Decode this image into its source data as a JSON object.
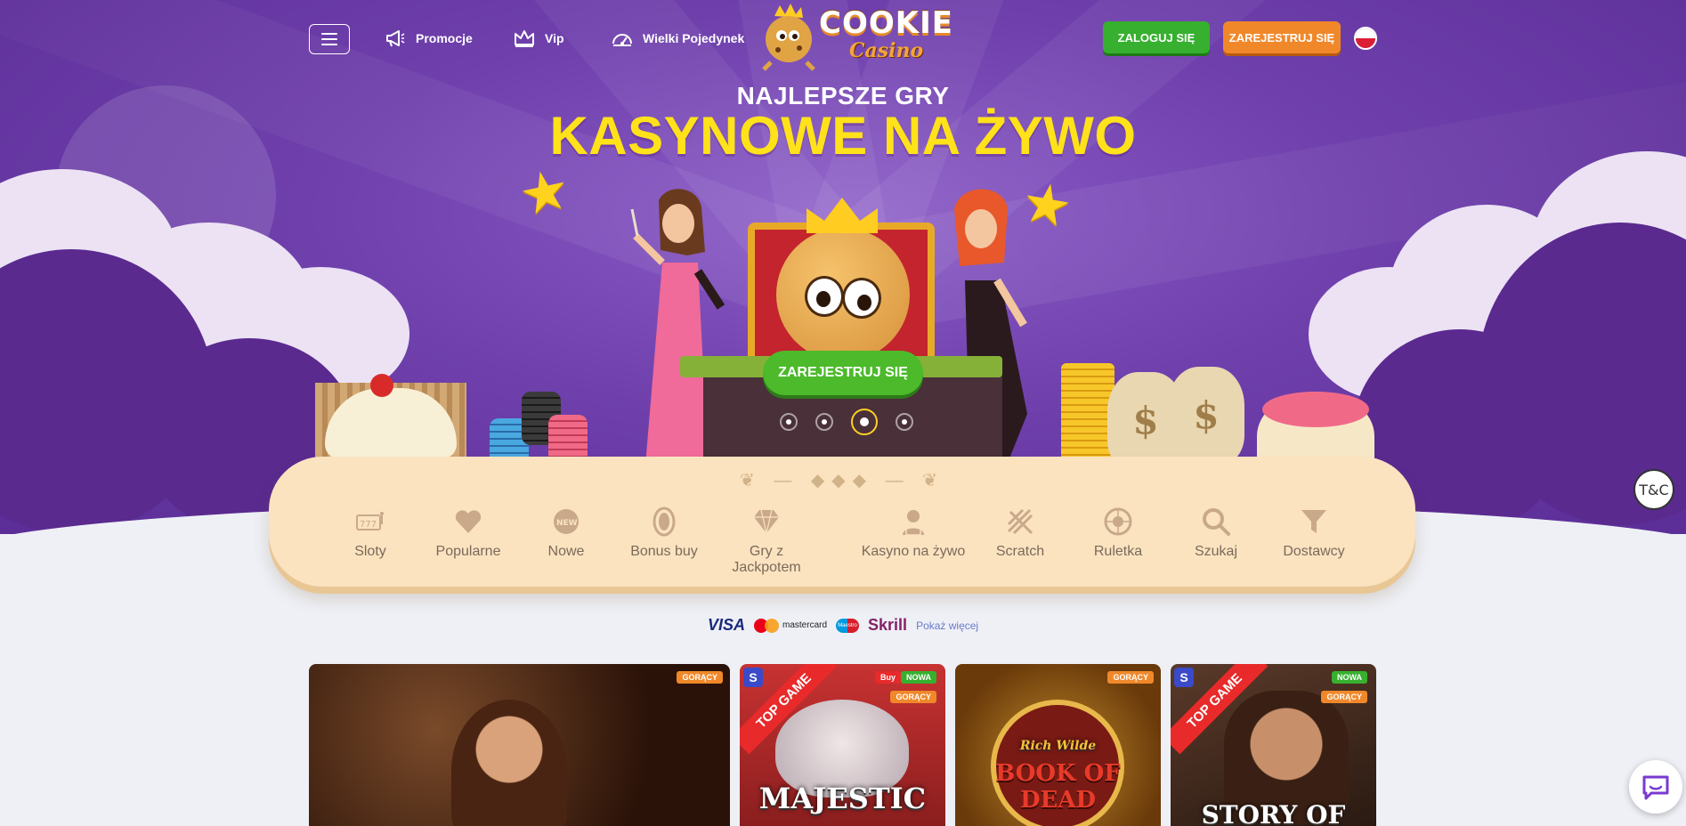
{
  "header": {
    "menu_icon": "hamburger-icon",
    "nav": [
      {
        "label": "Promocje",
        "icon": "megaphone-icon"
      },
      {
        "label": "Vip",
        "icon": "crown-icon"
      },
      {
        "label": "Wielki Pojedynek",
        "icon": "speedometer-icon"
      }
    ],
    "logo_text": "COOKIE",
    "logo_subtext": "Casino",
    "login_label": "ZALOGUJ SIĘ",
    "register_label": "ZAREJESTRUJ SIĘ",
    "language_flag": "poland-flag-icon"
  },
  "hero": {
    "headline_small": "NAJLEPSZE GRY",
    "headline_big": "KASYNOWE NA ŻYWO",
    "cta_label": "ZAREJESTRUJ SIĘ",
    "slides_total": 4,
    "slide_active": 3
  },
  "categories": [
    {
      "label": "Sloty",
      "icon": "slot-machine-icon"
    },
    {
      "label": "Popularne",
      "icon": "heart-icon"
    },
    {
      "label": "Nowe",
      "icon": "new-badge-icon"
    },
    {
      "label": "Bonus buy",
      "icon": "coin-icon"
    },
    {
      "label": "Gry z Jackpotem",
      "icon": "diamond-icon"
    },
    {
      "label": "Kasyno na żywo",
      "icon": "dealer-icon"
    },
    {
      "label": "Scratch",
      "icon": "scratch-icon"
    },
    {
      "label": "Ruletka",
      "icon": "roulette-icon"
    },
    {
      "label": "Szukaj",
      "icon": "search-icon"
    },
    {
      "label": "Dostawcy",
      "icon": "funnel-icon"
    }
  ],
  "tc_label": "T&C",
  "payments": {
    "visa": "VISA",
    "mastercard": "mastercard",
    "maestro": "Maestro",
    "skrill": "Skrill",
    "more_label": "Pokaż więcej"
  },
  "games": [
    {
      "badges": [
        "GORĄCY"
      ]
    },
    {
      "ribbon": "TOP GAME",
      "badges": [
        "NOWA",
        "GORĄCY"
      ],
      "title": "MAJESTIC",
      "buy_badge": "Buy"
    },
    {
      "badges": [
        "GORĄCY"
      ],
      "title_top": "Rich Wilde",
      "title": "BOOK OF DEAD"
    },
    {
      "ribbon": "TOP GAME",
      "badges": [
        "NOWA",
        "GORĄCY"
      ],
      "title": "STORY OF"
    }
  ],
  "colors": {
    "hero_purple": "#6f40ac",
    "headline_yellow": "#ffe21a",
    "login_green": "#36b02e",
    "register_orange": "#f0882a",
    "category_bar": "#fbe3c0"
  }
}
